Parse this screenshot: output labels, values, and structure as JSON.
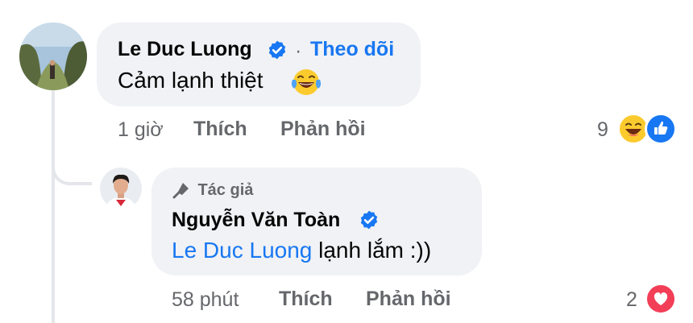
{
  "comment": {
    "author": "Le Duc Luong",
    "separator": "·",
    "follow_label": "Theo dõi",
    "text": "Cảm lạnh thiệt",
    "time": "1 giờ",
    "like_label": "Thích",
    "reply_label": "Phản hồi",
    "reaction_count": "9",
    "reactions": [
      "haha-icon",
      "like-icon"
    ]
  },
  "reply": {
    "badge_label": "Tác giả",
    "author": "Nguyễn Văn Toàn",
    "mention": "Le Duc Luong",
    "text": " lạnh lắm :))",
    "time": "58 phút",
    "like_label": "Thích",
    "reply_label": "Phản hồi",
    "reaction_count": "2",
    "reactions": [
      "love-icon"
    ]
  },
  "colors": {
    "bubble": "#f0f2f5",
    "link_blue": "#1877f2",
    "meta_gray": "#65676b",
    "love_red": "#f33e58"
  }
}
